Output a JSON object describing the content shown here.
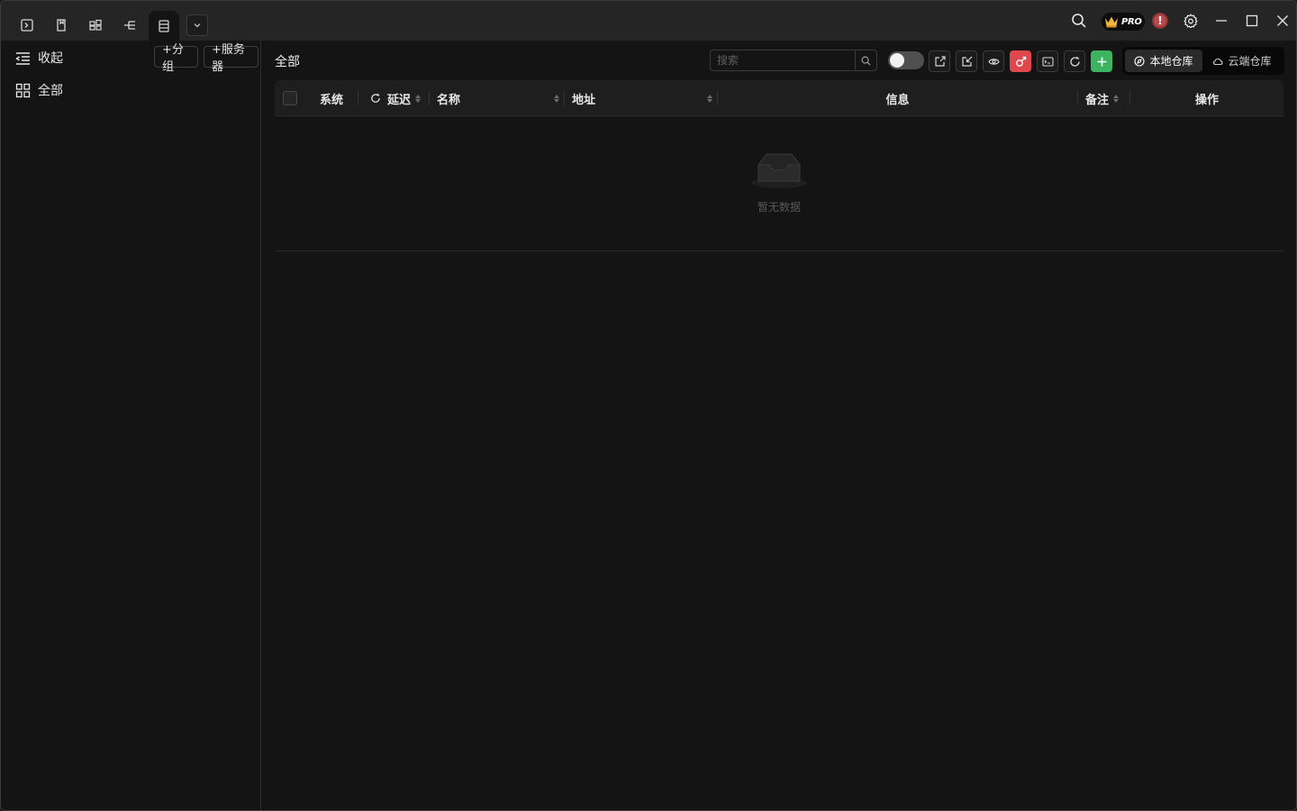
{
  "titlebar": {
    "tabs": [
      {
        "icon": "terminal-icon"
      },
      {
        "icon": "bookmark-icon"
      },
      {
        "icon": "grid-icon"
      },
      {
        "icon": "tree-icon"
      },
      {
        "icon": "server-list-icon",
        "active": true
      }
    ],
    "dropdown_icon": "chevron-down-icon",
    "pro_badge": "PRO",
    "alert_badge": "!",
    "controls": [
      "search-icon",
      "settings-icon",
      "minimize-icon",
      "maximize-icon",
      "close-icon"
    ]
  },
  "sidebar": {
    "collapse_label": "收起",
    "add_group_label": "+分组",
    "add_server_label": "+服务器",
    "items": [
      {
        "label": "全部",
        "icon": "grid-icon"
      }
    ]
  },
  "main": {
    "title": "全部",
    "search_placeholder": "搜索",
    "toggle_on": false,
    "toolbar_icons": [
      "export-icon",
      "import-icon",
      "eye-icon",
      "redis-icon",
      "terminal-batch-icon",
      "refresh-icon",
      "plus-icon"
    ],
    "accent_red": "#e0474c",
    "accent_green": "#3db35f",
    "repo_tabs": {
      "local": "本地仓库",
      "cloud": "云端仓库",
      "selected": "local"
    },
    "table": {
      "columns": [
        "系统",
        "延迟",
        "名称",
        "地址",
        "信息",
        "备注",
        "操作"
      ]
    },
    "empty_text": "暂无数据"
  }
}
